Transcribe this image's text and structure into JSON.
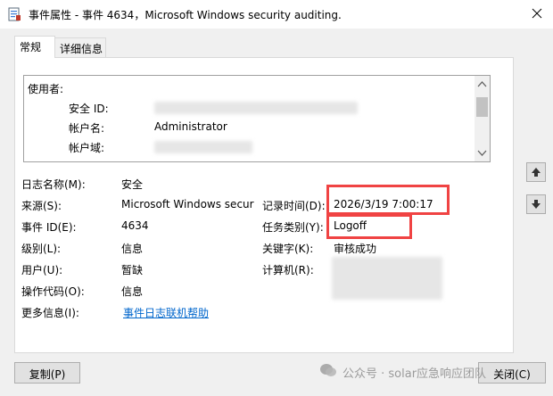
{
  "window": {
    "title": "事件属性 - 事件 4634，Microsoft Windows security auditing.",
    "colors": {
      "highlight_border": "#f04343",
      "link": "#0066cc"
    }
  },
  "tabs": [
    {
      "label": "常规",
      "active": true
    },
    {
      "label": "详细信息",
      "active": false
    }
  ],
  "description": {
    "heading": "使用者:",
    "rows": [
      {
        "label": "安全 ID:",
        "value": ""
      },
      {
        "label": "帐户名:",
        "value": "Administrator"
      },
      {
        "label": "帐户域:",
        "value": ""
      }
    ]
  },
  "fields": {
    "log_name": {
      "label": "日志名称(M):",
      "value": "安全"
    },
    "source": {
      "label": "来源(S):",
      "value": "Microsoft Windows secur"
    },
    "event_id": {
      "label": "事件 ID(E):",
      "value": "4634"
    },
    "level": {
      "label": "级别(L):",
      "value": "信息"
    },
    "user": {
      "label": "用户(U):",
      "value": "暂缺"
    },
    "opcode": {
      "label": "操作代码(O):",
      "value": "信息"
    },
    "more_info": {
      "label": "更多信息(I):",
      "value": "事件日志联机帮助"
    },
    "logged": {
      "label": "记录时间(D):",
      "value": "2026/3/19 7:00:17"
    },
    "task_category": {
      "label": "任务类别(Y):",
      "value": "Logoff"
    },
    "keywords": {
      "label": "关键字(K):",
      "value": "审核成功"
    },
    "computer": {
      "label": "计算机(R):",
      "value": ""
    }
  },
  "buttons": {
    "copy": "复制(P)",
    "close": "关闭(C)"
  },
  "watermark": "公众号 · solar应急响应团队",
  "icons": {
    "title": "event-properties-icon",
    "close": "close-icon",
    "up": "arrow-up-icon",
    "down": "arrow-down-icon"
  }
}
